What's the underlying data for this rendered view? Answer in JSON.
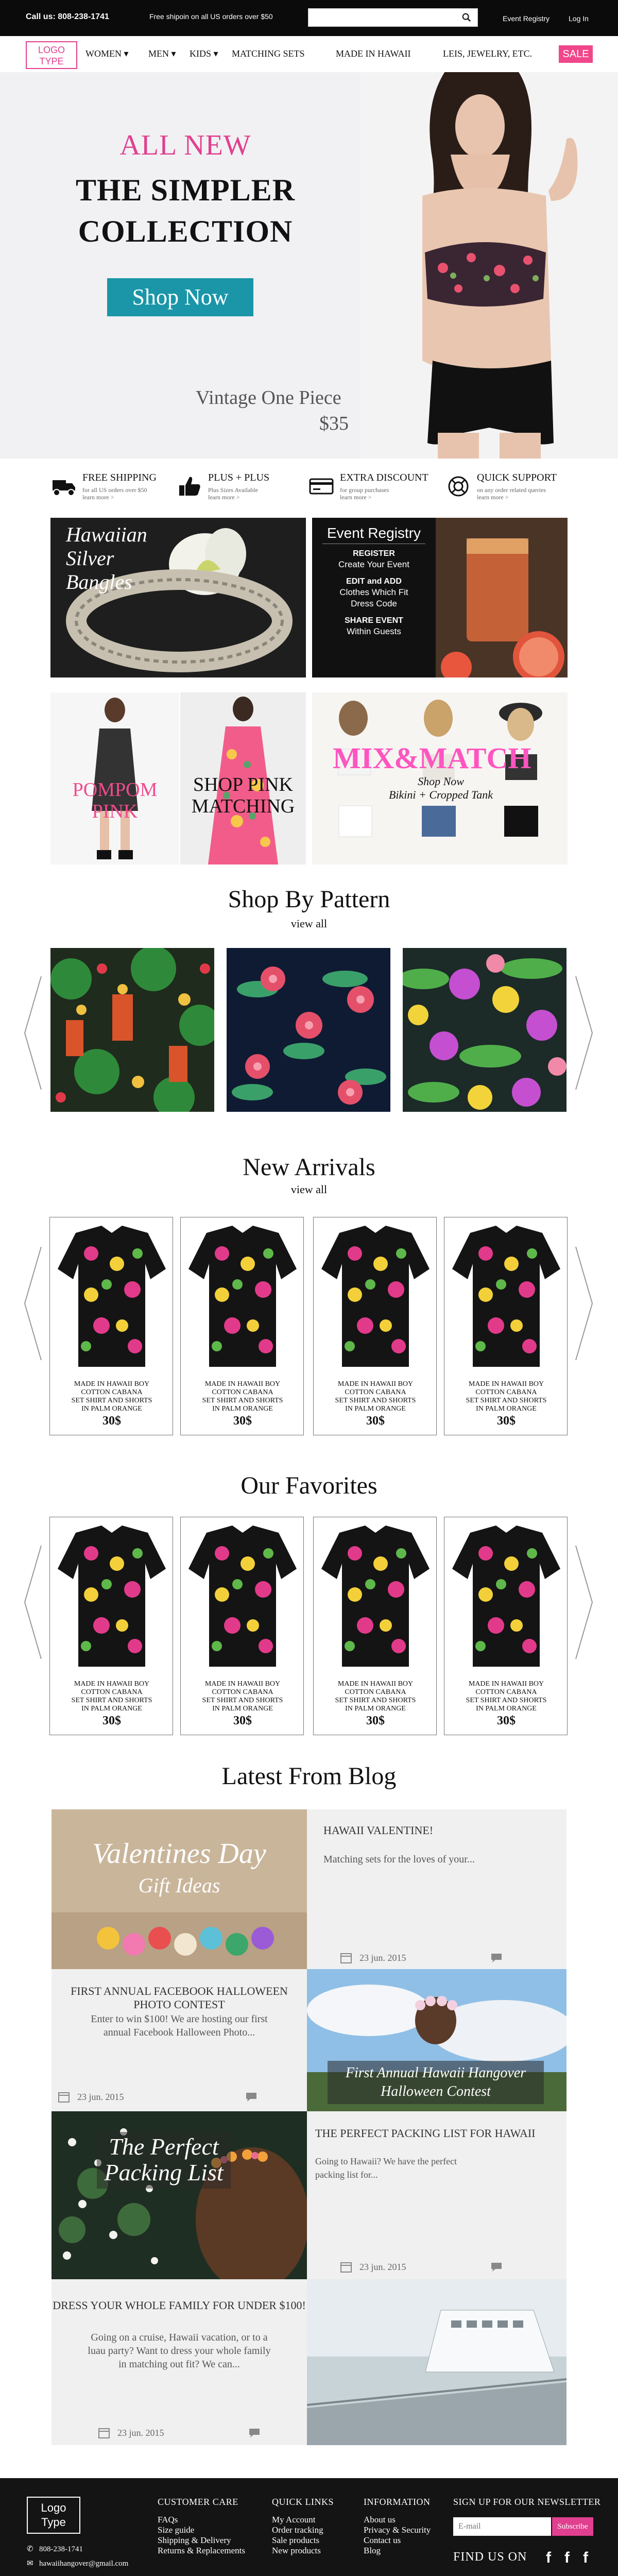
{
  "topbar": {
    "call": "Call us: 808-238-1741",
    "shipping": "Free shipoin on all US orders over $50",
    "search_placeholder": "",
    "event_registry": "Event Registry",
    "login": "Log In"
  },
  "nav": {
    "logo": [
      "LOGO",
      "TYPE"
    ],
    "items": [
      "WOMEN ▾",
      "MEN ▾",
      "KIDS ▾",
      "MATCHING SETS",
      "MADE IN HAWAII",
      "LEIS, JEWELRY, ETC."
    ],
    "sale": "SALE"
  },
  "hero": {
    "all_new": "ALL NEW",
    "title_line1": "THE SIMPLER",
    "title_line2": "COLLECTION",
    "button": "Shop Now",
    "product": "Vintage One Piece",
    "price": "$35"
  },
  "features": [
    {
      "title": "FREE SHIPPING",
      "sub1": "for all US orders over $50",
      "sub2": "learn more >",
      "icon": "truck-icon"
    },
    {
      "title": "PLUS + PLUS",
      "sub1": "Plus Sizes Available",
      "sub2": "learn more >",
      "icon": "thumbs-up-icon"
    },
    {
      "title": "EXTRA DISCOUNT",
      "sub1": "for group purchases",
      "sub2": "learn more >",
      "icon": "credit-card-icon"
    },
    {
      "title": "QUICK SUPPORT",
      "sub1": "on any order related queries",
      "sub2": "learn more >",
      "icon": "support-icon"
    }
  ],
  "promos": {
    "bangles": [
      "Hawaiian",
      "Silver",
      "Bangles"
    ],
    "registry": {
      "heading": "Event Registry",
      "lines": [
        {
          "text": "REGISTER",
          "bold": true
        },
        {
          "text": "Create Your Event",
          "bold": false
        },
        {
          "text": "EDIT and ADD",
          "bold": true
        },
        {
          "text": "Clothes Which Fit",
          "bold": false
        },
        {
          "text": "Dress Code",
          "bold": false
        },
        {
          "text": "SHARE EVENT",
          "bold": true
        },
        {
          "text": "Within Guests",
          "bold": false
        }
      ]
    },
    "pompom": [
      "POMPOM",
      "PINK"
    ],
    "shop_pink": [
      "SHOP PINK",
      "MATCHING"
    ],
    "mix_match": "MIX&MATCH",
    "shop_now": "Shop Now",
    "bikini": "Bikini + Cropped Tank"
  },
  "pattern": {
    "title": "Shop By Pattern",
    "view_all": "view all"
  },
  "new_arrivals": {
    "title": "New Arrivals",
    "view_all": "view all",
    "products": [
      {
        "desc": [
          "MADE IN HAWAII BOY",
          "COTTON CABANA",
          "SET SHIRT AND SHORTS",
          "IN PALM ORANGE"
        ],
        "price": "30$"
      },
      {
        "desc": [
          "MADE IN HAWAII BOY",
          "COTTON CABANA",
          "SET SHIRT AND SHORTS",
          "IN PALM ORANGE"
        ],
        "price": "30$"
      },
      {
        "desc": [
          "MADE IN HAWAII BOY",
          "COTTON CABANA",
          "SET SHIRT AND SHORTS",
          "IN PALM ORANGE"
        ],
        "price": "30$"
      },
      {
        "desc": [
          "MADE IN HAWAII BOY",
          "COTTON CABANA",
          "SET SHIRT AND SHORTS",
          "IN PALM ORANGE"
        ],
        "price": "30$"
      }
    ]
  },
  "favorites": {
    "title": "Our Favorites",
    "products": [
      {
        "desc": [
          "MADE IN HAWAII BOY",
          "COTTON CABANA",
          "SET SHIRT AND SHORTS",
          "IN PALM ORANGE"
        ],
        "price": "30$"
      },
      {
        "desc": [
          "MADE IN HAWAII BOY",
          "COTTON CABANA",
          "SET SHIRT AND SHORTS",
          "IN PALM ORANGE"
        ],
        "price": "30$"
      },
      {
        "desc": [
          "MADE IN HAWAII BOY",
          "COTTON CABANA",
          "SET SHIRT AND SHORTS",
          "IN PALM ORANGE"
        ],
        "price": "30$"
      },
      {
        "desc": [
          "MADE IN HAWAII BOY",
          "COTTON CABANA",
          "SET SHIRT AND SHORTS",
          "IN PALM ORANGE"
        ],
        "price": "30$"
      }
    ]
  },
  "blog": {
    "title": "Latest From Blog",
    "posts": [
      {
        "title": "HAWAII VALENTINE!",
        "excerpt": [
          "Matching sets for the loves of your..."
        ],
        "date": "23 jun. 2015",
        "image_text": [
          "Valentines Day",
          "Gift Ideas"
        ]
      },
      {
        "title": "FIRST ANNUAL FACEBOOK HALLOWEEN PHOTO CONTEST",
        "excerpt": [
          "Enter to win $100! We are hosting our first",
          "annual Facebook Halloween Photo..."
        ],
        "date": "23 jun. 2015",
        "image_text": [
          "First Annual Hawaii Hangover",
          "Halloween Contest"
        ]
      },
      {
        "title": "THE PERFECT PACKING LIST FOR HAWAII",
        "excerpt": [
          "Going to Hawaii? We have the perfect",
          "packing list for..."
        ],
        "date": "23 jun. 2015",
        "image_text": [
          "The Perfect",
          "Packing List"
        ]
      },
      {
        "title": "DRESS YOUR WHOLE FAMILY FOR UNDER $100!",
        "excerpt": [
          "Going on a cruise, Hawaii vacation, or to a",
          "luau party? Want to dress your whole family",
          "in matching out fit? We can..."
        ],
        "date": "23 jun. 2015"
      }
    ]
  },
  "footer": {
    "logo": [
      "Logo",
      "Type"
    ],
    "phone": "808-238-1741",
    "email": "hawaiihangover@gmail.com",
    "columns": [
      {
        "heading": "CUSTOMER CARE",
        "links": [
          "FAQs",
          "Size guide",
          "Shipping & Delivery",
          "Returns & Replacements"
        ]
      },
      {
        "heading": "QUICK LINKS",
        "links": [
          "My Account",
          "Order tracking",
          "Sale products",
          "New products"
        ]
      },
      {
        "heading": "INFORMATION",
        "links": [
          "About us",
          "Privacy & Security",
          "Contact us",
          "Blog"
        ]
      }
    ],
    "newsletter": "SIGN UP FOR OUR NEWSLETTER",
    "email_placeholder": "E-mail",
    "subscribe": "Subscribe",
    "find_us": "FIND US ON",
    "social": [
      "f",
      "f",
      "f"
    ]
  },
  "colors": {
    "pink": "#e0408f",
    "teal": "#1a96a8",
    "black": "#0b0b0b"
  }
}
